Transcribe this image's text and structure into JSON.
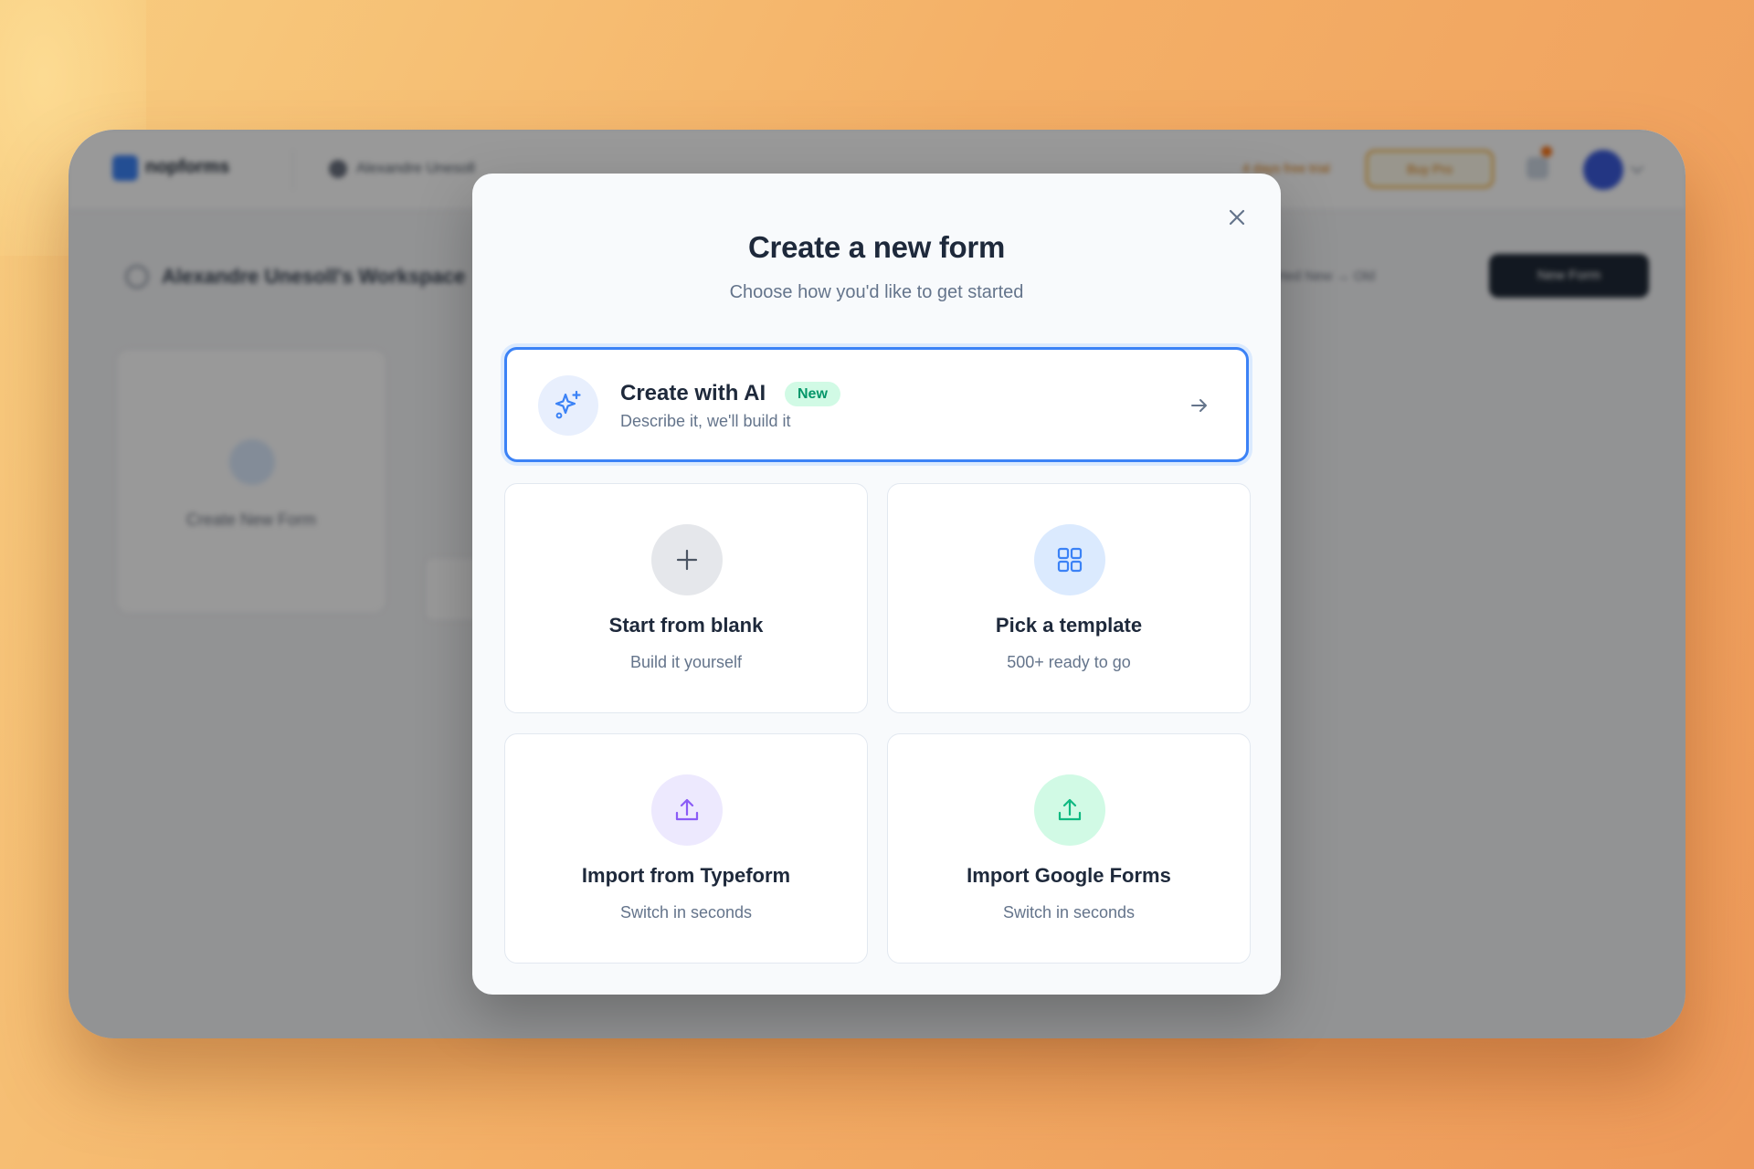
{
  "background_app": {
    "logo_text": "nopforms",
    "workspace_name": "Alexandre Unesoll",
    "trial_text": "4 days free trial",
    "buy_label": "Buy Pro",
    "workspace_title": "Alexandre Unesoll's Workspace",
    "sort_label": "Sorted New → Old",
    "new_form_button": "New Form",
    "create_card_label": "Create New Form"
  },
  "modal": {
    "title": "Create a new form",
    "subtitle": "Choose how you'd like to get started",
    "ai_option": {
      "title": "Create with AI",
      "badge": "New",
      "description": "Describe it, we'll build it"
    },
    "options": [
      {
        "title": "Start from blank",
        "description": "Build it yourself"
      },
      {
        "title": "Pick a template",
        "description": "500+ ready to go"
      },
      {
        "title": "Import from Typeform",
        "description": "Switch in seconds"
      },
      {
        "title": "Import Google Forms",
        "description": "Switch in seconds"
      }
    ]
  },
  "icons": {
    "close": "close-icon",
    "ai": "sparkles-icon",
    "arrow": "arrow-right-icon",
    "blank": "plus-icon",
    "template": "grid-icon",
    "typeform": "upload-icon",
    "google": "upload-icon"
  },
  "colors": {
    "accent": "#3b82f6",
    "badge_bg": "#d1fae5",
    "badge_text": "#059669",
    "typeform_icon": "#8b5cf6",
    "google_icon": "#10b981"
  }
}
